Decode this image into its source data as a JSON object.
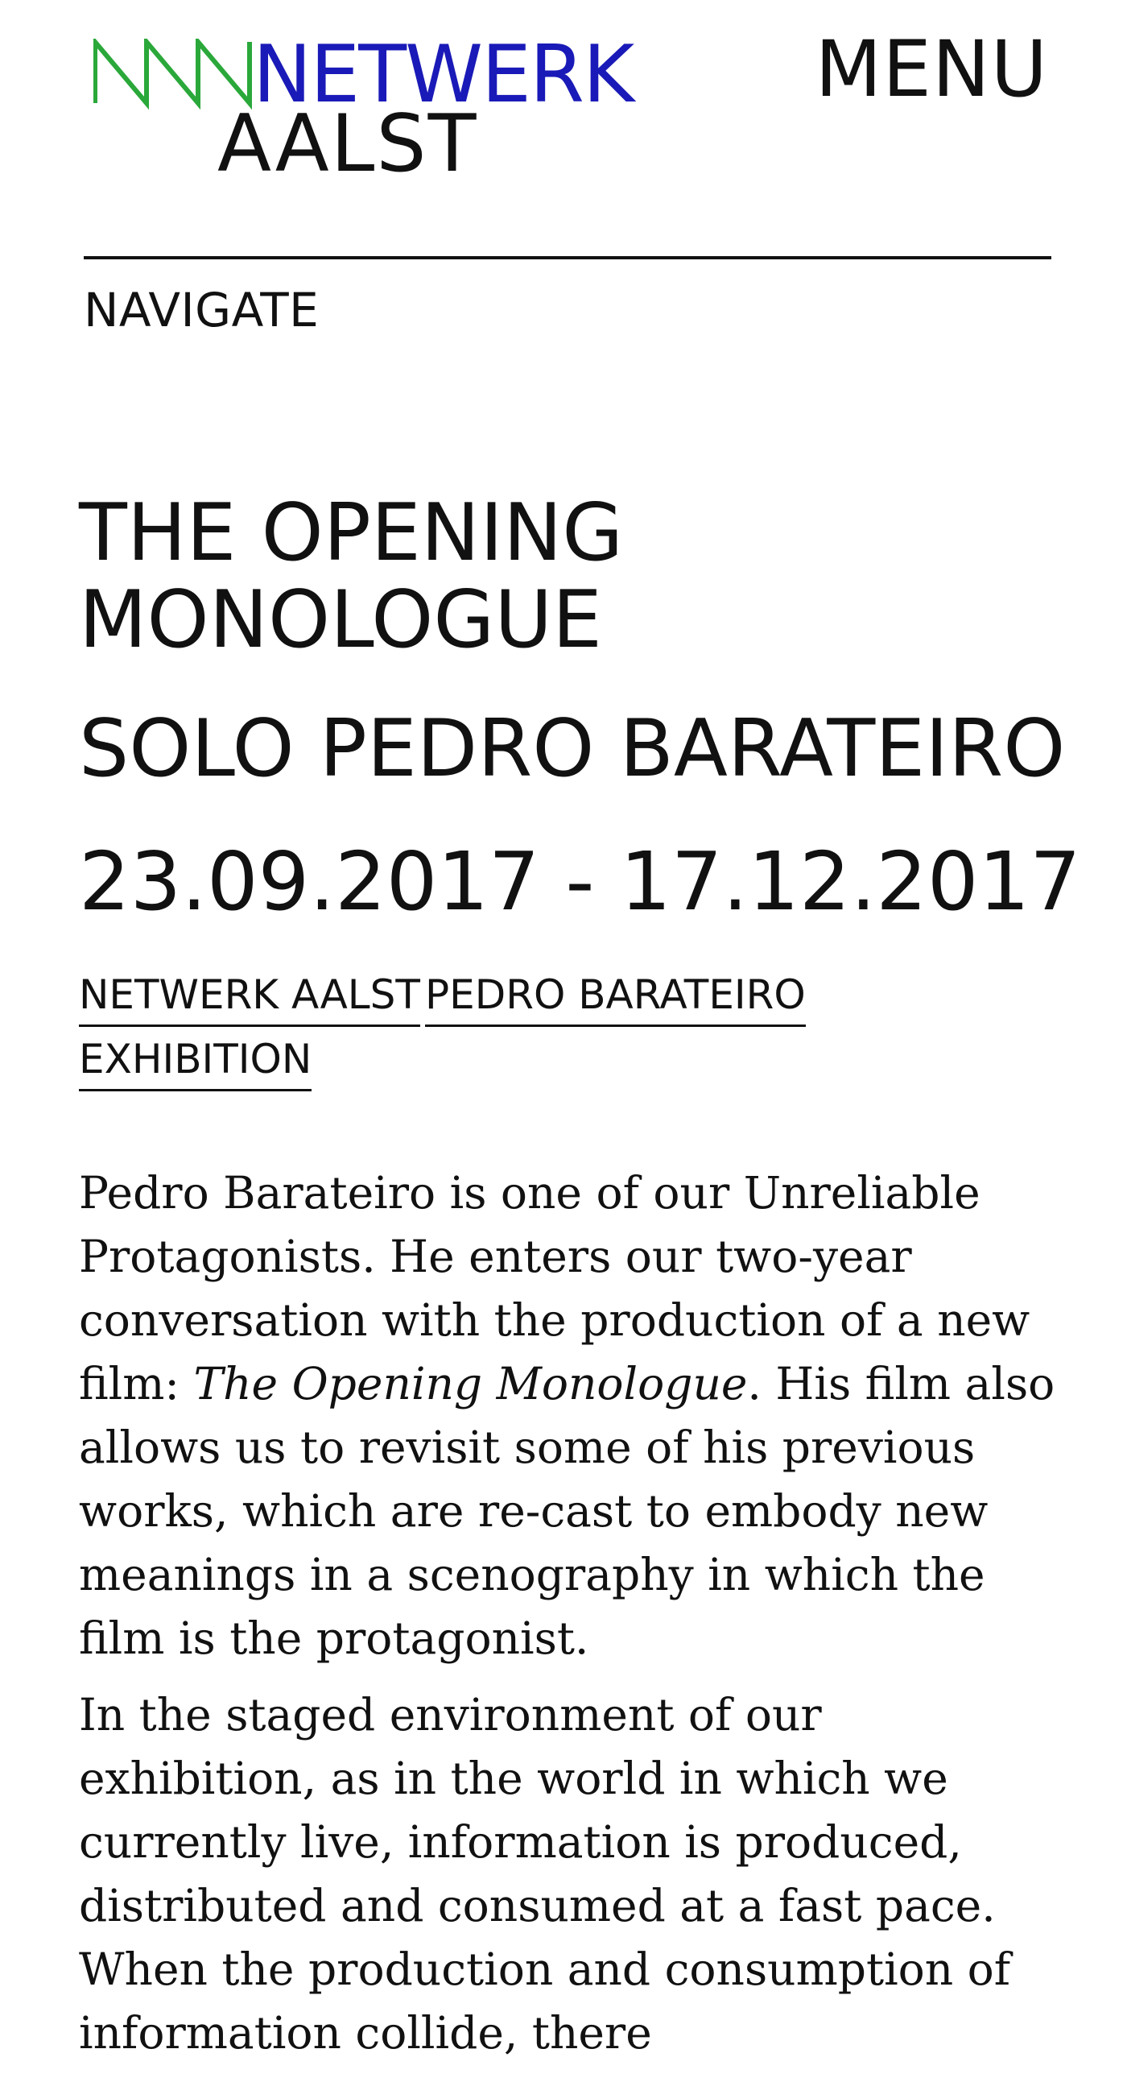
{
  "header": {
    "logo_netwerk": "NETWERK",
    "logo_aalst": "AALST",
    "logo_colors": {
      "zigzag": "#2aa83a",
      "netwerk": "#1a1ab8",
      "aalst": "#111111"
    },
    "menu_label": "MENU"
  },
  "nav": {
    "navigate_label": "NAVIGATE"
  },
  "exhibition": {
    "title": "THE OPENING MONOLOGUE",
    "subtitle": "SOLO PEDRO BARATEIRO",
    "dates": "23.09.2017 - 17.12.2017"
  },
  "tags": [
    "NETWERK AALST",
    "PEDRO BARATEIRO",
    "EXHIBITION"
  ],
  "body": {
    "p1_before": "Pedro Barateiro is one of our Unreliable Protagonists. He enters our two-year conversation with the production of a new film: ",
    "p1_em": "The Opening Monologue",
    "p1_after": ". His film also allows us to revisit some of his previous works, which are re-cast to embody new meanings in a scenography in which the film is the protagonist.",
    "p2": "In the staged environment of our exhibition, as in the world in which we currently live, information is produced, distributed and consumed at a fast pace. When the production and consumption of information collide, there"
  }
}
